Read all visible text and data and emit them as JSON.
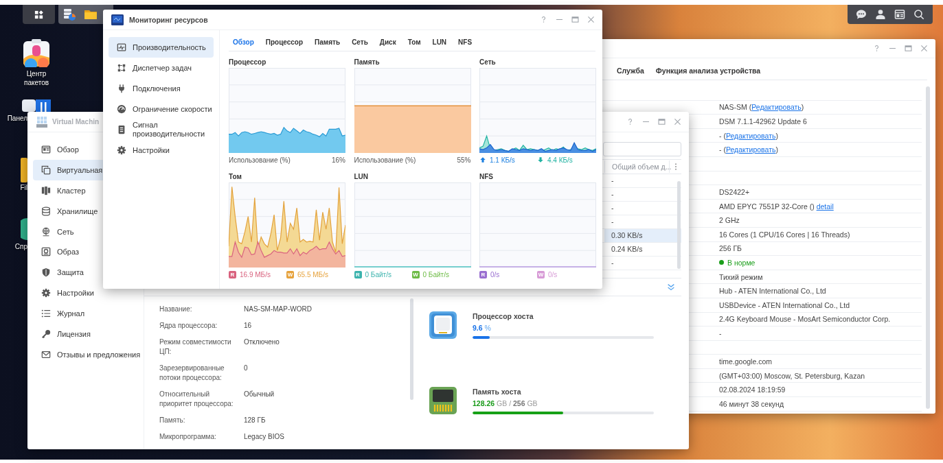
{
  "desktop_icons": [
    {
      "label": "Центр пакетов"
    },
    {
      "label": "Панел"
    },
    {
      "label": "Fil"
    },
    {
      "label": "Спр"
    }
  ],
  "system_info": {
    "tabs": [
      {
        "label": "Служба",
        "selected": false
      },
      {
        "label": "Функция анализа устройства",
        "selected": false
      }
    ],
    "rows": [
      {
        "kind": "blank"
      },
      {
        "kind": "link",
        "prefix": "NAS-SM (",
        "link": "Редактировать",
        "suffix": ")"
      },
      {
        "kind": "text",
        "text": "DSM 7.1.1-42962 Update 6"
      },
      {
        "kind": "link",
        "prefix": "- (",
        "link": "Редактировать",
        "suffix": ")"
      },
      {
        "kind": "link",
        "prefix": "- (",
        "link": "Редактировать",
        "suffix": ")"
      },
      {
        "kind": "blank"
      },
      {
        "kind": "blank"
      },
      {
        "kind": "text",
        "text": "DS2422+"
      },
      {
        "kind": "link",
        "prefix": "AMD EPYC 7551P 32-Core () ",
        "link": "detail"
      },
      {
        "kind": "text",
        "text": "2 GHz"
      },
      {
        "kind": "text",
        "text": "16 Cores (1 CPU/16 Cores | 16 Threads)"
      },
      {
        "kind": "text",
        "text": "256 ГБ"
      },
      {
        "kind": "status",
        "text": "В норме",
        "color": "#1a9e1a"
      },
      {
        "kind": "text",
        "text": "Тихий режим"
      },
      {
        "kind": "text",
        "text": "Hub - ATEN International Co., Ltd"
      },
      {
        "kind": "text",
        "text": "USBDevice - ATEN International Co., Ltd"
      },
      {
        "kind": "text",
        "text": "2.4G Keyboard Mouse - MosArt Semiconductor Corp."
      },
      {
        "kind": "text",
        "text": "-"
      },
      {
        "kind": "blank"
      },
      {
        "kind": "text",
        "text": "time.google.com"
      },
      {
        "kind": "text",
        "text": "(GMT+03:00) Moscow, St. Petersburg, Kazan"
      },
      {
        "kind": "text",
        "text": "02.08.2024 18:19:59"
      },
      {
        "kind": "text",
        "text": "46 минут 38 секунд"
      }
    ]
  },
  "vm_manager": {
    "title": "Virtual Machin",
    "sidebar": [
      {
        "label": "Обзор",
        "selected": false
      },
      {
        "label": "Виртуальная",
        "selected": true
      },
      {
        "label": "Кластер",
        "selected": false
      },
      {
        "label": "Хранилище",
        "selected": false
      },
      {
        "label": "Сеть",
        "selected": false
      },
      {
        "label": "Образ",
        "selected": false
      },
      {
        "label": "Защита",
        "selected": false
      },
      {
        "label": "Настройки",
        "selected": false
      },
      {
        "label": "Журнал",
        "selected": false
      },
      {
        "label": "Лицензия",
        "selected": false
      },
      {
        "label": "Отзывы и предложения",
        "selected": false
      }
    ],
    "table": {
      "columns": [
        "Общий объем д..."
      ],
      "rows": [
        {
          "cells": [
            "-"
          ],
          "selected": false
        },
        {
          "cells": [
            "-"
          ],
          "selected": false
        },
        {
          "cells": [
            "-"
          ],
          "selected": false
        },
        {
          "cells": [
            "-"
          ],
          "selected": false
        },
        {
          "cells": [
            "0.30 KB/s"
          ],
          "selected": true
        },
        {
          "cells": [
            "0.24 KB/s"
          ],
          "selected": false
        },
        {
          "cells": [
            "-"
          ],
          "selected": false
        }
      ]
    },
    "details": [
      {
        "label": "Название:",
        "value": "NAS-SM-MAP-WORD"
      },
      {
        "label": "Ядра процессора:",
        "value": "16"
      },
      {
        "label": "Режим совместимости ЦП:",
        "value": "Отключено"
      },
      {
        "label": "Зарезервированные потоки процессора:",
        "value": "0"
      },
      {
        "label": "Относительный приоритет процессора:",
        "value": "Обычный"
      },
      {
        "label": "Память:",
        "value": "128 ГБ"
      },
      {
        "label": "Микропрограмма:",
        "value": "Legacy BIOS"
      }
    ],
    "host": [
      {
        "kind": "cpu",
        "title": "Процессор хоста",
        "reading": "**9.6** %",
        "level": 0.096
      },
      {
        "kind": "memory",
        "title": "Память хоста",
        "reading": "**128.26** GB / **256** GB",
        "level": 0.5
      }
    ]
  },
  "resource_monitor": {
    "title": "Мониторинг ресурсов",
    "sidebar": [
      {
        "label": "Производительность",
        "selected": true
      },
      {
        "label": "Диспетчер задач",
        "selected": false
      },
      {
        "label": "Подключения",
        "selected": false
      },
      {
        "label": "Ограничение скорости",
        "selected": false
      },
      {
        "label": "Сигнал производительности",
        "selected": false
      },
      {
        "label": "Настройки",
        "selected": false
      }
    ],
    "tabs": [
      {
        "label": "Обзор",
        "selected": true
      },
      {
        "label": "Процессор",
        "selected": false
      },
      {
        "label": "Память",
        "selected": false
      },
      {
        "label": "Сеть",
        "selected": false
      },
      {
        "label": "Диск",
        "selected": false
      },
      {
        "label": "Том",
        "selected": false
      },
      {
        "label": "LUN",
        "selected": false
      },
      {
        "label": "NFS",
        "selected": false
      }
    ],
    "panels": [
      {
        "title": "Процессор",
        "kind": "cpu",
        "label": "Использование (%)",
        "value": "16%"
      },
      {
        "title": "Память",
        "kind": "memory",
        "label": "Использование (%)",
        "value": "55%"
      },
      {
        "title": "Сеть",
        "kind": "network",
        "readings": [
          {
            "text": "1.1 КБ/s",
            "color": "#1a7fe0"
          },
          {
            "text": "4.4 КБ/s",
            "color": "#22b3a3"
          }
        ]
      },
      {
        "title": "Том",
        "kind": "volume",
        "readings": [
          {
            "badge": "R",
            "text": "16.9 МБ/s",
            "color": "#d9637f"
          },
          {
            "badge": "W",
            "text": "65.5 МБ/s",
            "color": "#e6a23c"
          }
        ]
      },
      {
        "title": "LUN",
        "kind": "lun",
        "readings": [
          {
            "badge": "R",
            "text": "0 Байт/s",
            "color": "#3bb3ad"
          },
          {
            "badge": "W",
            "text": "0 Байт/s",
            "color": "#6dbb45"
          }
        ]
      },
      {
        "title": "NFS",
        "kind": "nfs",
        "readings": [
          {
            "badge": "R",
            "text": "0/s",
            "color": "#9a6fd0"
          },
          {
            "badge": "W",
            "text": "0/s",
            "color": "#d79ad6"
          }
        ]
      }
    ]
  }
}
